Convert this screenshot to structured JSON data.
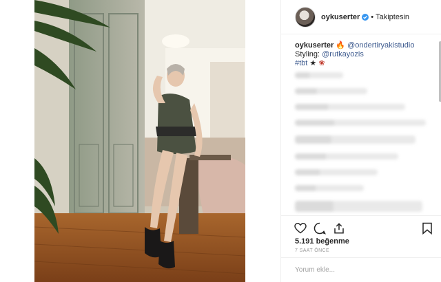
{
  "post": {
    "username": "oykuserter",
    "follow_status": "Takiptesin",
    "separator": "•",
    "caption": {
      "username": "oykuserter",
      "mention1": "@ondertiryakistudio",
      "styling_label": "Styling:",
      "mention2": "@rutkayozis",
      "hashtag": "#tbt"
    },
    "likes": "5.191 beğenme",
    "time": "7 SAAT ÖNCE",
    "comment_placeholder": "Yorum ekle..."
  },
  "icons": [
    "verified-icon",
    "fire-icon",
    "star-icon",
    "rose-icon",
    "heart-icon",
    "comment-icon",
    "share-icon",
    "bookmark-icon"
  ],
  "colors": {
    "link": "#3d5a8e",
    "verified": "#3897f0"
  }
}
